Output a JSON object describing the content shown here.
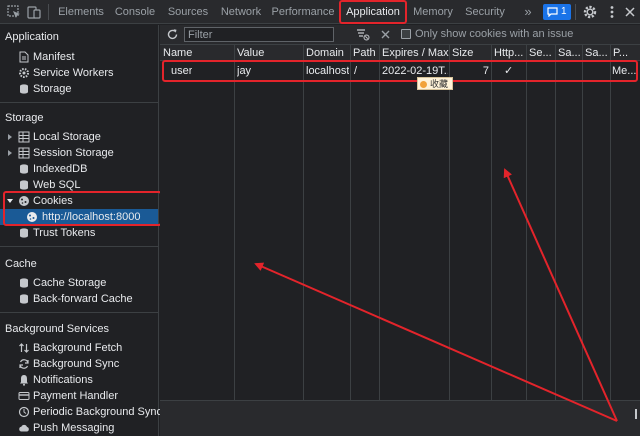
{
  "toolbar": {
    "tabs": [
      {
        "label": "Elements"
      },
      {
        "label": "Console"
      },
      {
        "label": "Sources"
      },
      {
        "label": "Network"
      },
      {
        "label": "Performance"
      },
      {
        "label": "Application"
      },
      {
        "label": "Memory"
      },
      {
        "label": "Security"
      }
    ],
    "active_tab": "Application",
    "more_label": "»",
    "issues_count": "1"
  },
  "sidebar": {
    "sections": [
      {
        "title": "Application",
        "items": [
          {
            "label": "Manifest",
            "icon": "document-icon"
          },
          {
            "label": "Service Workers",
            "icon": "gear-icon"
          },
          {
            "label": "Storage",
            "icon": "database-icon"
          }
        ]
      },
      {
        "title": "Storage",
        "items": [
          {
            "label": "Local Storage",
            "icon": "grid-icon"
          },
          {
            "label": "Session Storage",
            "icon": "grid-icon"
          },
          {
            "label": "IndexedDB",
            "icon": "database-icon"
          },
          {
            "label": "Web SQL",
            "icon": "database-icon"
          },
          {
            "label": "Cookies",
            "icon": "cookie-icon"
          },
          {
            "label": "http://localhost:8000",
            "icon": "cookie-icon"
          },
          {
            "label": "Trust Tokens",
            "icon": "database-icon"
          }
        ]
      },
      {
        "title": "Cache",
        "items": [
          {
            "label": "Cache Storage",
            "icon": "database-icon"
          },
          {
            "label": "Back-forward Cache",
            "icon": "database-icon"
          }
        ]
      },
      {
        "title": "Background Services",
        "items": [
          {
            "label": "Background Fetch",
            "icon": "updown-arrows-icon"
          },
          {
            "label": "Background Sync",
            "icon": "sync-icon"
          },
          {
            "label": "Notifications",
            "icon": "bell-icon"
          },
          {
            "label": "Payment Handler",
            "icon": "card-icon"
          },
          {
            "label": "Periodic Background Sync",
            "icon": "clock-icon"
          },
          {
            "label": "Push Messaging",
            "icon": "cloud-icon"
          }
        ]
      }
    ]
  },
  "cookies": {
    "filter_placeholder": "Filter",
    "only_issue_label": "Only show cookies with an issue",
    "columns": [
      "Name",
      "Value",
      "Domain",
      "Path",
      "Expires / Max...",
      "Size",
      "Http...",
      "Se...",
      "Sa...",
      "Sa...",
      "P..."
    ],
    "rows": [
      {
        "name": "user",
        "value": "jay",
        "domain": "localhost",
        "path": "/",
        "expires": "2022-02-19T...",
        "size": "7",
        "httponly": "✓",
        "secure": "",
        "samesite": "",
        "sameparty": "",
        "priority": "Me..."
      }
    ],
    "tooltip": "收藏"
  },
  "colors": {
    "background": "#202124",
    "panel": "#292a2d",
    "selected": "#1a5a96",
    "annotation_red": "#e3242b",
    "accent_blue": "#1a73e8"
  }
}
